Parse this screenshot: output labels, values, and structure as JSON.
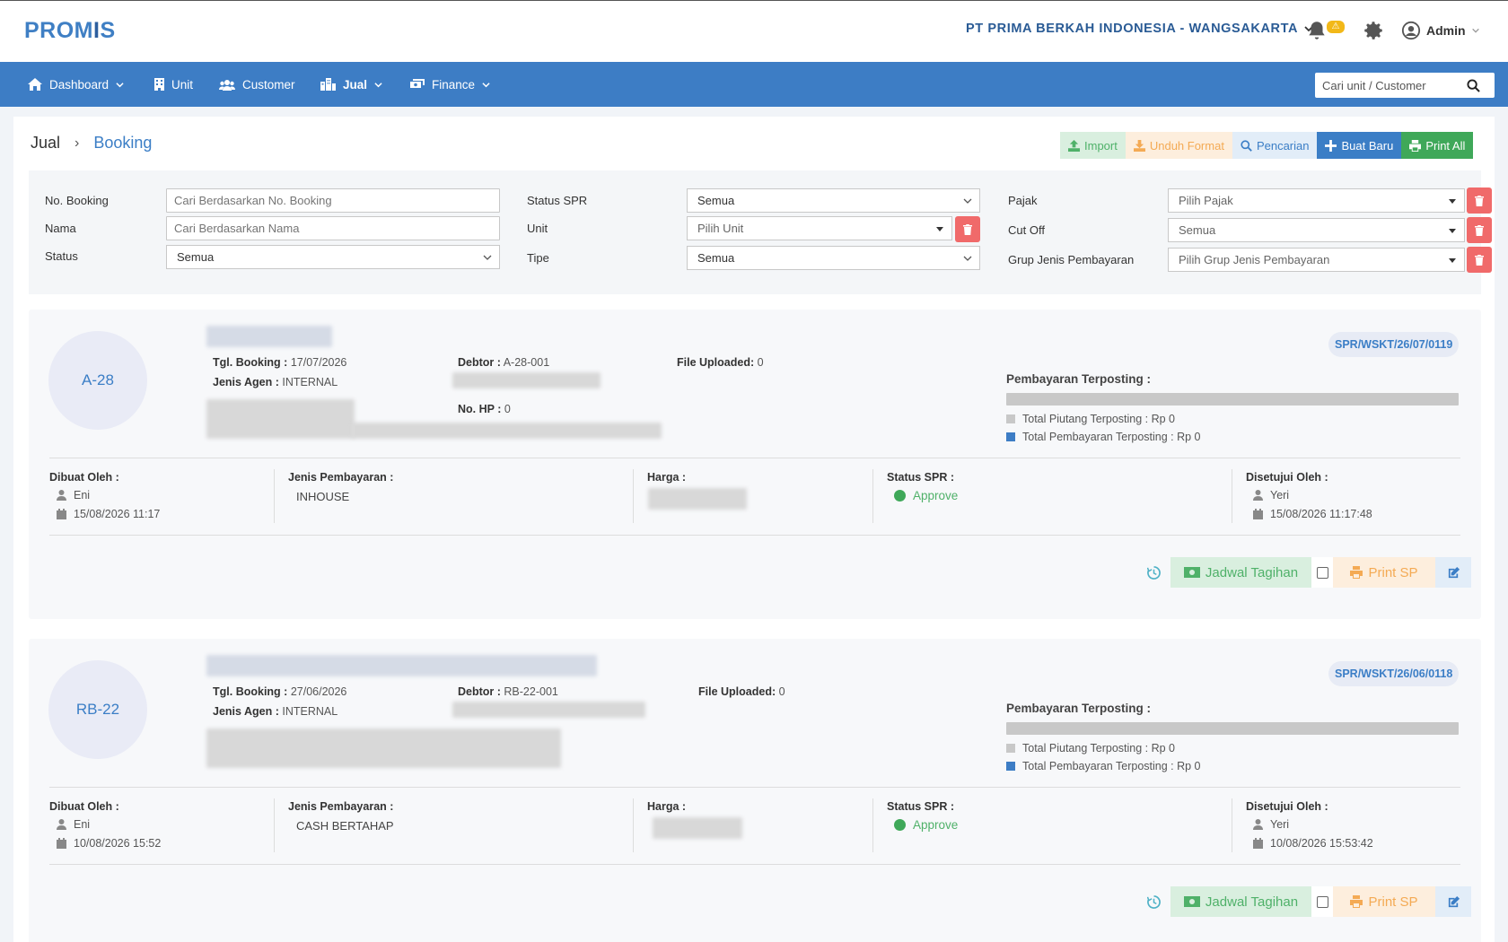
{
  "app": {
    "logo_main": "PROM",
    "logo_accent": "I",
    "logo_tail": "S",
    "company": "PT PRIMA BERKAH INDONESIA - WANGSAKARTA",
    "notification_badge": "⚠",
    "user": "Admin"
  },
  "nav": {
    "items": [
      {
        "label": "Dashboard",
        "icon": "home-icon"
      },
      {
        "label": "Unit",
        "icon": "building-icon"
      },
      {
        "label": "Customer",
        "icon": "users-icon"
      },
      {
        "label": "Jual",
        "icon": "city-icon"
      },
      {
        "label": "Finance",
        "icon": "money-icon"
      }
    ],
    "search_placeholder": "Cari unit / Customer"
  },
  "breadcrumb": {
    "parent": "Jual",
    "current": "Booking"
  },
  "actions": {
    "import": "Import",
    "unduh": "Unduh Format",
    "pencarian": "Pencarian",
    "buat": "Buat Baru",
    "print_all": "Print All"
  },
  "filters": {
    "no_booking": {
      "label": "No. Booking",
      "placeholder": "Cari Berdasarkan No. Booking"
    },
    "nama": {
      "label": "Nama",
      "placeholder": "Cari Berdasarkan Nama"
    },
    "status": {
      "label": "Status",
      "value": "Semua"
    },
    "status_spr": {
      "label": "Status SPR",
      "value": "Semua"
    },
    "unit": {
      "label": "Unit",
      "value": "Pilih Unit"
    },
    "tipe": {
      "label": "Tipe",
      "value": "Semua"
    },
    "pajak": {
      "label": "Pajak",
      "value": "Pilih Pajak"
    },
    "cut_off": {
      "label": "Cut Off",
      "value": "Semua"
    },
    "grup": {
      "label": "Grup Jenis Pembayaran",
      "value": "Pilih Grup Jenis Pembayaran"
    }
  },
  "labels": {
    "tgl_booking": "Tgl. Booking :",
    "jenis_agen": "Jenis Agen :",
    "debtor": "Debtor :",
    "no_hp": "No. HP :",
    "file_uploaded": "File Uploaded:",
    "pembayaran_terposting": "Pembayaran Terposting :",
    "total_piutang": "Total Piutang Terposting : Rp 0",
    "total_pembayaran": "Total Pembayaran Terposting : Rp 0",
    "dibuat_oleh": "Dibuat Oleh :",
    "jenis_pembayaran": "Jenis Pembayaran :",
    "harga": "Harga :",
    "status_spr": "Status SPR :",
    "disetujui_oleh": "Disetujui Oleh :",
    "jadwal_tagihan": "Jadwal Tagihan",
    "print_sp": "Print SP"
  },
  "bookings": [
    {
      "unit": "A-28",
      "tgl_booking": "17/07/2026",
      "jenis_agen": "INTERNAL",
      "debtor": "A-28-001",
      "no_hp": "0",
      "file_uploaded": "0",
      "spr": "SPR/WSKT/26/07/0119",
      "dibuat_oleh": "Eni",
      "dibuat_tanggal": "15/08/2026 11:17",
      "jenis_pembayaran": "INHOUSE",
      "status_spr": "Approve",
      "disetujui_oleh": "Yeri",
      "disetujui_tanggal": "15/08/2026 11:17:48"
    },
    {
      "unit": "RB-22",
      "tgl_booking": "27/06/2026",
      "jenis_agen": "INTERNAL",
      "debtor": "RB-22-001",
      "file_uploaded": "0",
      "spr": "SPR/WSKT/26/06/0118",
      "dibuat_oleh": "Eni",
      "dibuat_tanggal": "10/08/2026 15:52",
      "jenis_pembayaran": "CASH BERTAHAP",
      "status_spr": "Approve",
      "disetujui_oleh": "Yeri",
      "disetujui_tanggal": "10/08/2026 15:53:42"
    }
  ],
  "colors": {
    "brand": "#3d7dc5",
    "danger": "#f06a6a",
    "success": "#3fa859",
    "warning": "#f4aa54"
  }
}
